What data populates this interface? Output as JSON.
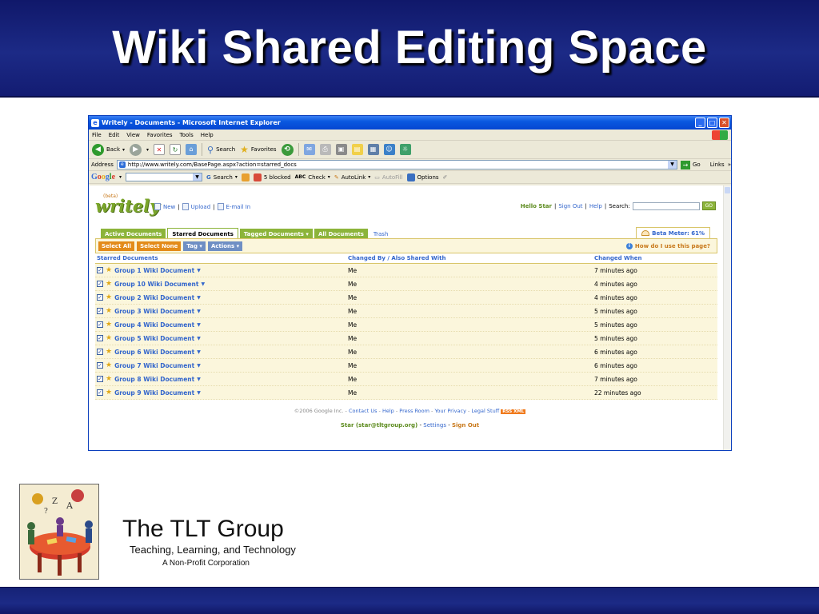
{
  "slide": {
    "title": "Wiki Shared Editing Space"
  },
  "browser": {
    "window_title": "Writely - Documents - Microsoft Internet Explorer",
    "menu": [
      "File",
      "Edit",
      "View",
      "Favorites",
      "Tools",
      "Help"
    ],
    "toolbar": {
      "back": "Back",
      "search": "Search",
      "favorites": "Favorites"
    },
    "address_label": "Address",
    "url": "http://www.writely.com/BasePage.aspx?action=starred_docs",
    "go": "Go",
    "links": "Links",
    "google_bar": {
      "logo": "Google",
      "search": "Search",
      "blocked": "5 blocked",
      "check": "Check",
      "autolink": "AutoLink",
      "autofill": "AutoFill",
      "options": "Options"
    }
  },
  "app": {
    "logo_beta": "(beta)",
    "logo": "writely",
    "nav": {
      "new": "New",
      "upload": "Upload",
      "email": "E-mail In"
    },
    "user": {
      "hello": "Hello Star",
      "sign_out": "Sign Out",
      "help": "Help",
      "search_label": "Search:",
      "go": "GO"
    },
    "tabs": [
      "Active Documents",
      "Starred Documents",
      "Tagged Documents ▾",
      "All Documents",
      "Trash"
    ],
    "beta_meter": "Beta Meter: 61%",
    "actions": {
      "select_all": "Select All",
      "select_none": "Select None",
      "tag": "Tag ▾",
      "actions": "Actions ▾",
      "help_question": "How do I use this page?"
    },
    "table": {
      "headers": [
        "Starred Documents",
        "Changed By / Also Shared With",
        "Changed When"
      ],
      "rows": [
        {
          "name": "Group 1 Wiki Document",
          "by": "Me",
          "when": "7 minutes ago"
        },
        {
          "name": "Group 10 Wiki Document",
          "by": "Me",
          "when": "4 minutes ago"
        },
        {
          "name": "Group 2 Wiki Document",
          "by": "Me",
          "when": "4 minutes ago"
        },
        {
          "name": "Group 3 Wiki Document",
          "by": "Me",
          "when": "5 minutes ago"
        },
        {
          "name": "Group 4 Wiki Document",
          "by": "Me",
          "when": "5 minutes ago"
        },
        {
          "name": "Group 5 Wiki Document",
          "by": "Me",
          "when": "5 minutes ago"
        },
        {
          "name": "Group 6 Wiki Document",
          "by": "Me",
          "when": "6 minutes ago"
        },
        {
          "name": "Group 7 Wiki Document",
          "by": "Me",
          "when": "6 minutes ago"
        },
        {
          "name": "Group 8 Wiki Document",
          "by": "Me",
          "when": "7 minutes ago"
        },
        {
          "name": "Group 9 Wiki Document",
          "by": "Me",
          "when": "22 minutes ago"
        }
      ]
    },
    "footer": {
      "copyright": "©2006 Google Inc.",
      "links": [
        "Contact Us",
        "Help",
        "Press Room",
        "Your Privacy",
        "Legal Stuff"
      ],
      "rss": "RSS XML",
      "user": "Star (star@tltgroup.org)",
      "settings": "Settings",
      "sign_out": "Sign Out"
    }
  },
  "tlt": {
    "name": "The TLT Group",
    "subtitle": "Teaching, Learning, and Technology",
    "nonprofit": "A Non-Profit Corporation"
  }
}
